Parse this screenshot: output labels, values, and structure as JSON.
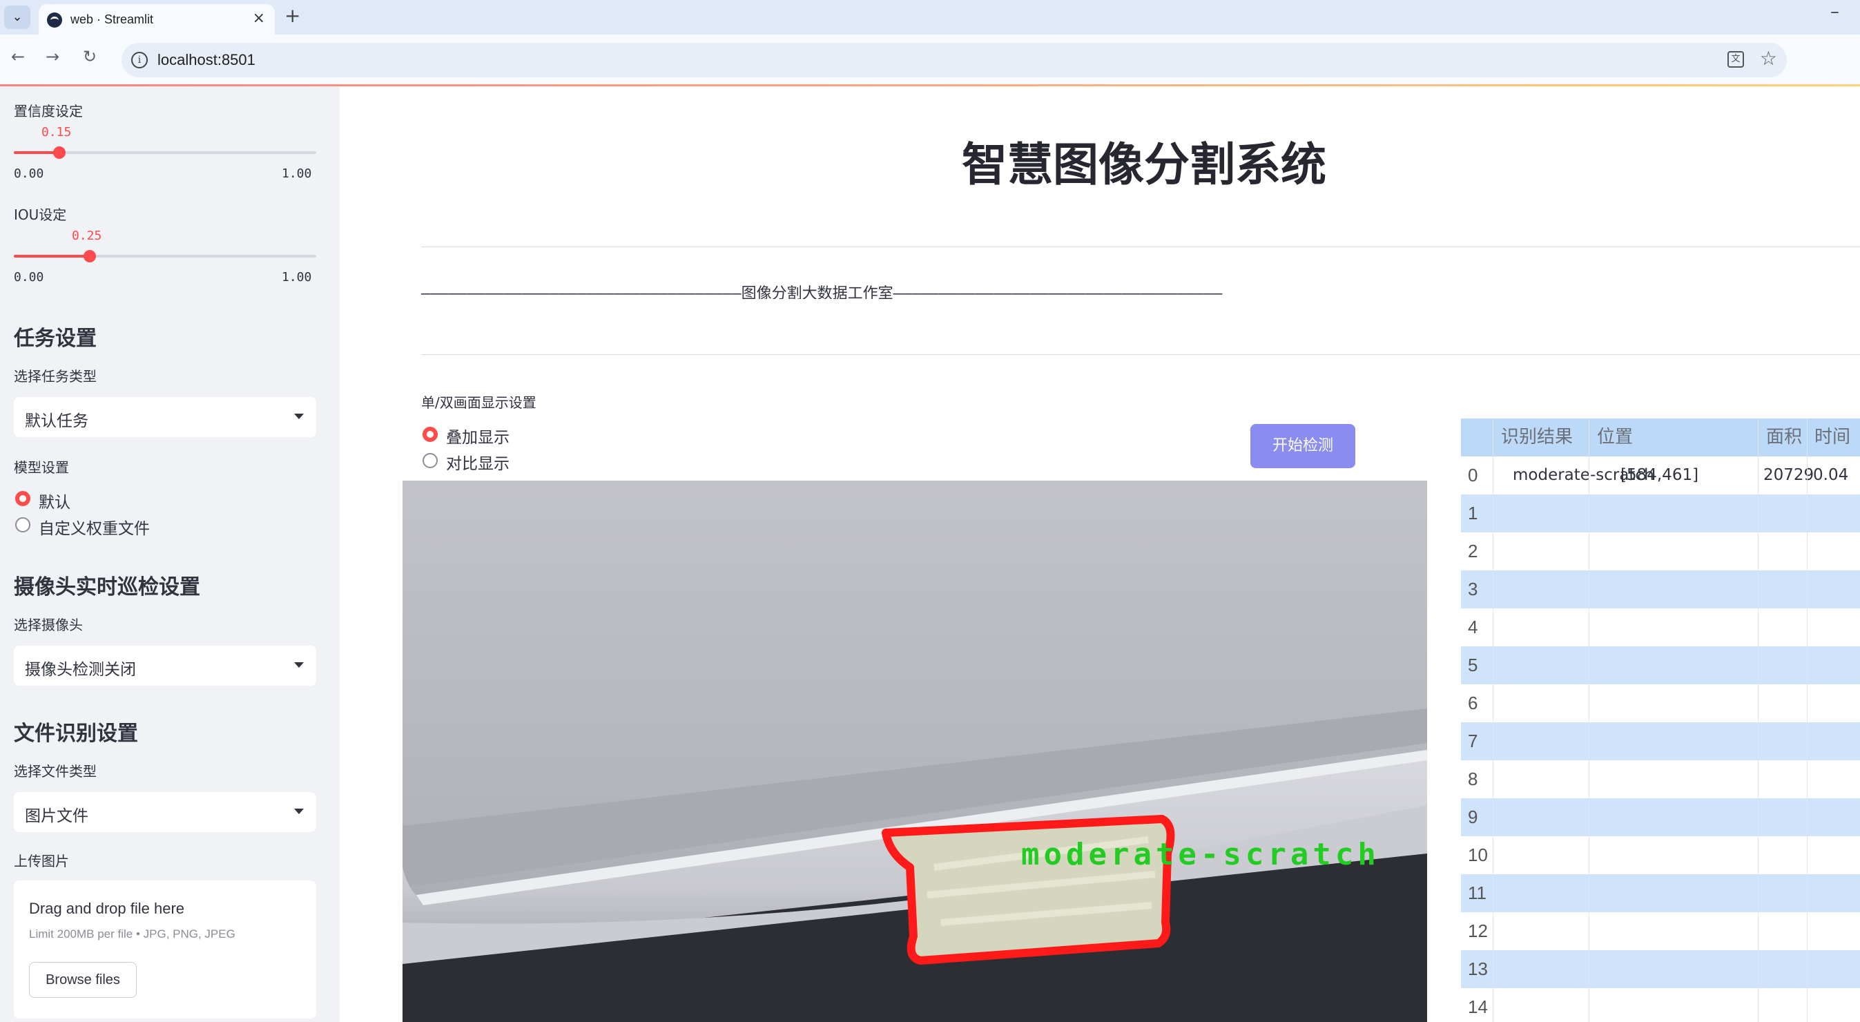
{
  "browser": {
    "tab_title": "web · Streamlit",
    "url": "localhost:8501"
  },
  "sidebar": {
    "confidence": {
      "label": "置信度设定",
      "value": "0.15",
      "min": "0.00",
      "max": "1.00",
      "fraction": 0.15
    },
    "iou": {
      "label": "IOU设定",
      "value": "0.25",
      "min": "0.00",
      "max": "1.00",
      "fraction": 0.25
    },
    "task_heading": "任务设置",
    "task_type_label": "选择任务类型",
    "task_type_value": "默认任务",
    "model_label": "模型设置",
    "model_options": [
      "默认",
      "自定义权重文件"
    ],
    "model_selected": 0,
    "camera_heading": "摄像头实时巡检设置",
    "camera_label": "选择摄像头",
    "camera_value": "摄像头检测关闭",
    "file_heading": "文件识别设置",
    "file_type_label": "选择文件类型",
    "file_type_value": "图片文件",
    "upload_label": "上传图片",
    "uploader_title": "Drag and drop file here",
    "uploader_limit": "Limit 200MB per file • JPG, PNG, JPEG",
    "browse_label": "Browse files"
  },
  "main": {
    "title": "智慧图像分割系统",
    "dashed_banner": "———————————————————————————————————图像分割大数据工作室————————————————————————————————————",
    "display_label": "单/双画面显示设置",
    "display_options": [
      "叠加显示",
      "对比显示"
    ],
    "display_selected": 0,
    "start_button": "开始检测",
    "detection_label": "moderate-scratch",
    "colors": {
      "accent": "#ff4b4b",
      "button": "#8b8cf0",
      "mask_outline": "#ff1a1a",
      "label_green": "#22cc22"
    }
  },
  "table": {
    "headers": [
      "识别结果",
      "位置",
      "面积",
      "时间"
    ],
    "rows": [
      {
        "index": "0",
        "result": "moderate-scratch",
        "position": "[584,461]",
        "area": "20729",
        "time": "0.04"
      },
      {
        "index": "1",
        "result": "",
        "position": "",
        "area": "",
        "time": ""
      },
      {
        "index": "2",
        "result": "",
        "position": "",
        "area": "",
        "time": ""
      },
      {
        "index": "3",
        "result": "",
        "position": "",
        "area": "",
        "time": ""
      },
      {
        "index": "4",
        "result": "",
        "position": "",
        "area": "",
        "time": ""
      },
      {
        "index": "5",
        "result": "",
        "position": "",
        "area": "",
        "time": ""
      },
      {
        "index": "6",
        "result": "",
        "position": "",
        "area": "",
        "time": ""
      },
      {
        "index": "7",
        "result": "",
        "position": "",
        "area": "",
        "time": ""
      },
      {
        "index": "8",
        "result": "",
        "position": "",
        "area": "",
        "time": ""
      },
      {
        "index": "9",
        "result": "",
        "position": "",
        "area": "",
        "time": ""
      },
      {
        "index": "10",
        "result": "",
        "position": "",
        "area": "",
        "time": ""
      },
      {
        "index": "11",
        "result": "",
        "position": "",
        "area": "",
        "time": ""
      },
      {
        "index": "12",
        "result": "",
        "position": "",
        "area": "",
        "time": ""
      },
      {
        "index": "13",
        "result": "",
        "position": "",
        "area": "",
        "time": ""
      },
      {
        "index": "14",
        "result": "",
        "position": "",
        "area": "",
        "time": ""
      }
    ]
  }
}
